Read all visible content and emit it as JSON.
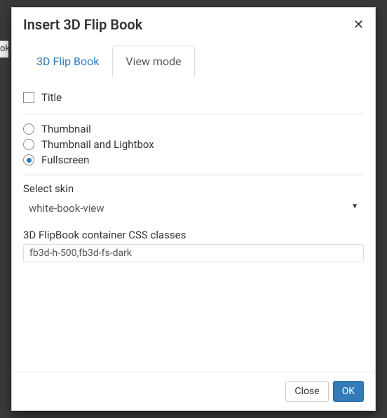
{
  "bg_fragment": "ok",
  "modal": {
    "title": "Insert 3D Flip Book",
    "close_icon": "✕"
  },
  "tabs": {
    "items": [
      {
        "label": "3D Flip Book",
        "active": false
      },
      {
        "label": "View mode",
        "active": true
      }
    ]
  },
  "viewmode": {
    "title_checkbox_label": "Title",
    "title_checked": false,
    "radios": [
      {
        "label": "Thumbnail",
        "selected": false
      },
      {
        "label": "Thumbnail and Lightbox",
        "selected": false
      },
      {
        "label": "Fullscreen",
        "selected": true
      }
    ],
    "skin_label": "Select skin",
    "skin_value": "white-book-view",
    "css_label": "3D FlipBook container CSS classes",
    "css_value": "fb3d-h-500,fb3d-fs-dark"
  },
  "footer": {
    "close": "Close",
    "ok": "OK"
  }
}
